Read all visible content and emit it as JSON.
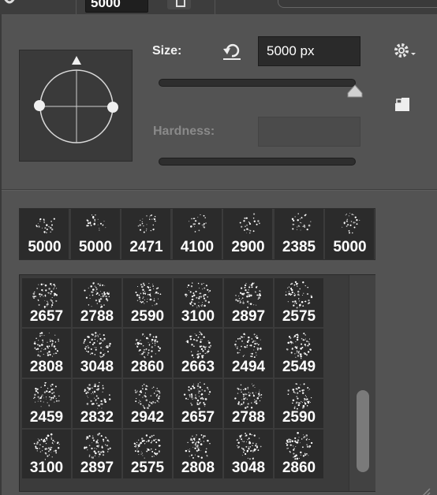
{
  "toolbar": {
    "size_value": "5000"
  },
  "brush_popup": {
    "size_label": "Size:",
    "size_value": "5000 px",
    "size_slider_fraction": 0.97,
    "hardness_label": "Hardness:",
    "hardness_value": "",
    "icons": {
      "reset": "reset-arrow-icon",
      "gear": "gear-icon",
      "panel": "new-preset-icon",
      "angle": "brush-angle-roundness-icon",
      "resize": "resize-grip-icon"
    }
  },
  "recent_brushes": [
    "5000",
    "5000",
    "2471",
    "4100",
    "2900",
    "2385",
    "5000"
  ],
  "brush_presets": [
    [
      "2657",
      "2788",
      "2590",
      "3100",
      "2897",
      "2575"
    ],
    [
      "2808",
      "3048",
      "2860",
      "2663",
      "2494",
      "2549"
    ],
    [
      "2459",
      "2832",
      "2942",
      "2657",
      "2788",
      "2590"
    ],
    [
      "3100",
      "2897",
      "2575",
      "2808",
      "3048",
      "2860"
    ]
  ],
  "colors": {
    "panel_bg": "#535353",
    "field_bg": "#2a2a2a",
    "cell_bg": "#2b2b2b",
    "text": "#ffffff"
  }
}
